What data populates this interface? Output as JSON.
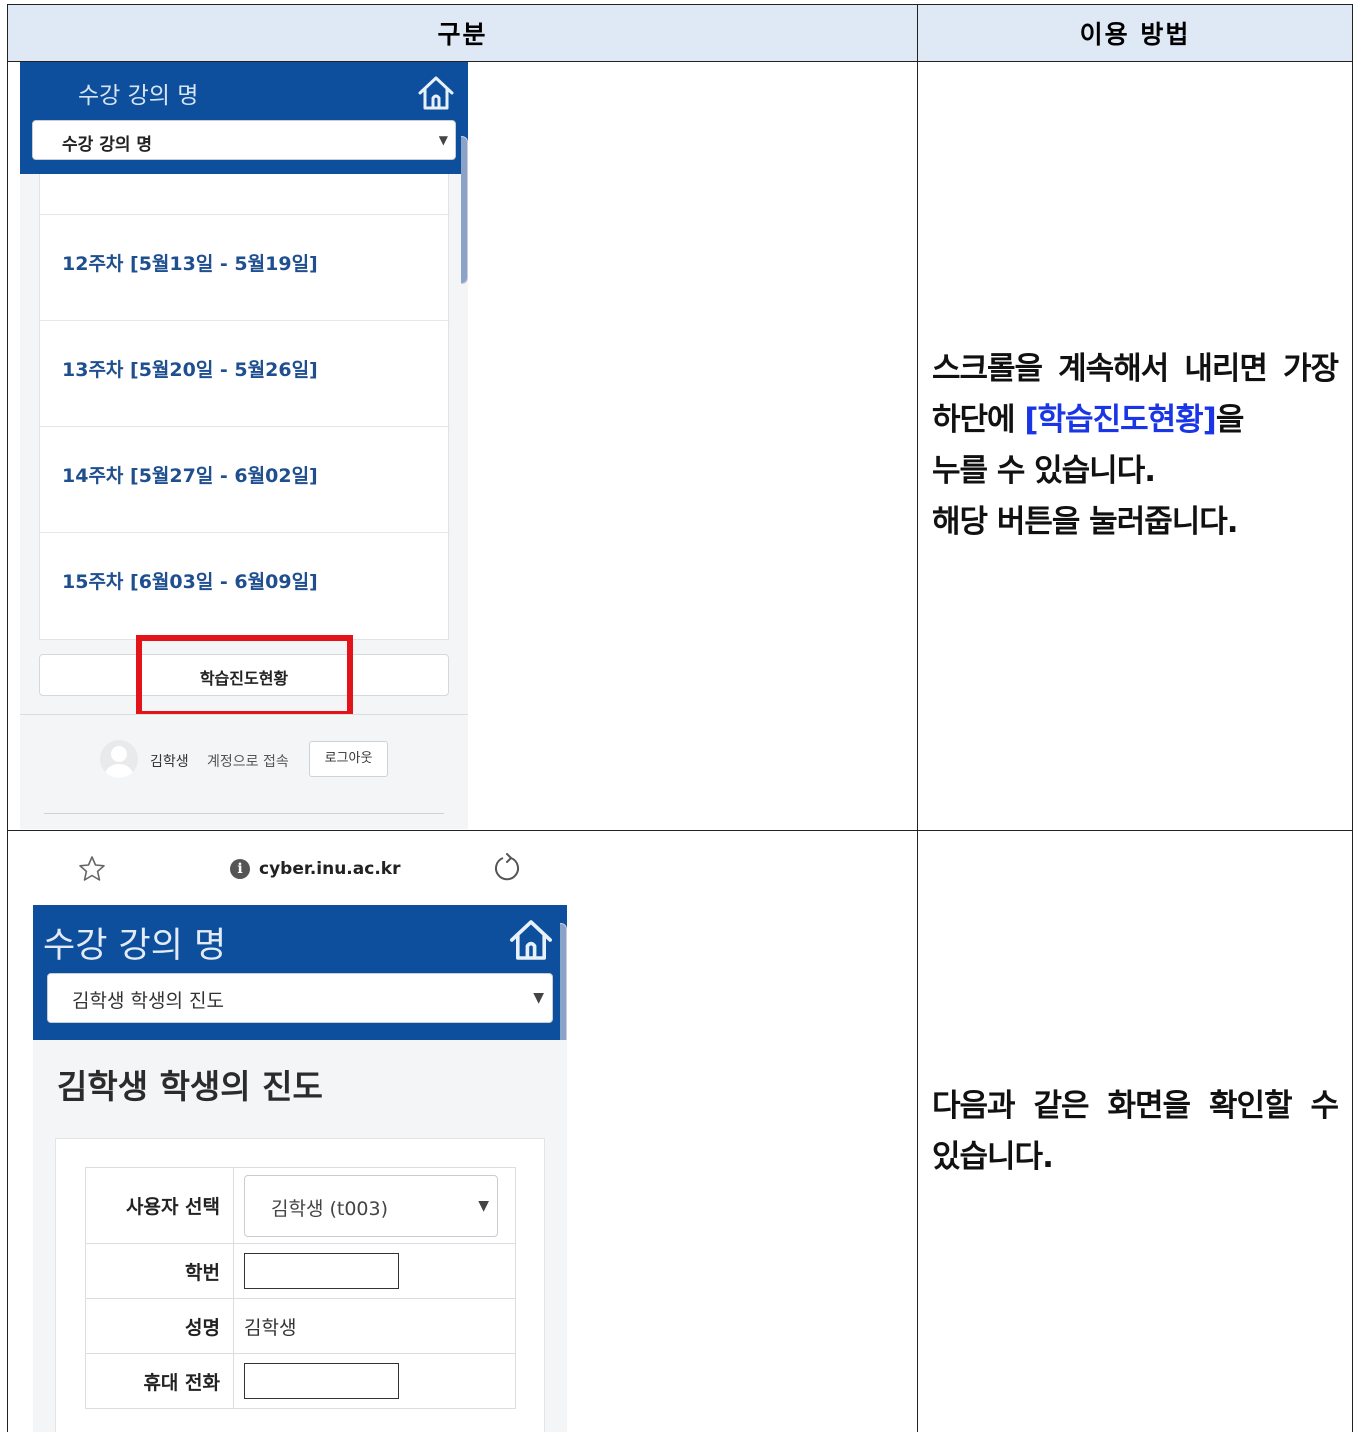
{
  "table": {
    "header_left": "구분",
    "header_right": "이용 방법"
  },
  "row1": {
    "screenshot": {
      "course_title": "수강 강의 명",
      "course_select": "수강 강의 명",
      "weeks": [
        "12주차 [5월13일 - 5월19일]",
        "13주차 [5월20일 - 5월26일]",
        "14주차 [5월27일 - 6월02일]",
        "15주차 [6월03일 - 6월09일]"
      ],
      "progress_button": "학습진도현황",
      "user_name": "김학생",
      "login_text": "계정으로 접속",
      "logout_button": "로그아웃",
      "highlight_color": "#e31419"
    },
    "instruction": {
      "line1": "스크롤을 계속해서 내리면 가장",
      "line2_pre": "하단에 ",
      "line2_highlight": "[학습진도현황]",
      "line2_post": "을",
      "line3": "누를 수 있습니다.",
      "line4": "해당 버튼을 눌러줍니다.",
      "highlight_color": "#1a35e6"
    }
  },
  "row2": {
    "screenshot": {
      "browser_url": "cyber.inu.ac.kr",
      "course_title": "수강 강의 명",
      "course_select": "김학생 학생의 진도",
      "page_heading": "김학생 학생의 진도",
      "form": {
        "user_select_label": "사용자 선택",
        "user_select_value": "김학생 (t003)",
        "student_id_label": "학번",
        "student_id_value": "",
        "name_label": "성명",
        "name_value": "김학생",
        "phone_label": "휴대 전화",
        "phone_value": ""
      }
    },
    "instruction": {
      "line1": "다음과 같은 화면을 확인할 수",
      "line2": "있습니다."
    }
  },
  "colors": {
    "header_bg": "#dfe9f5",
    "brand_blue": "#0d4f9c",
    "week_text": "#1f4f8f"
  }
}
